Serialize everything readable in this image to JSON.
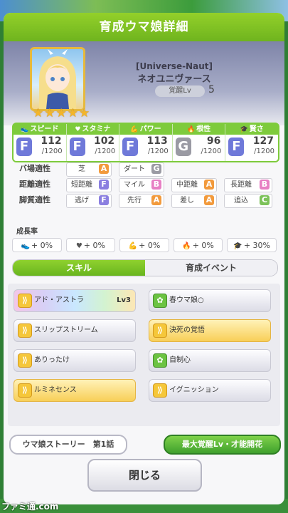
{
  "dialog": {
    "title": "育成ウマ娘詳細",
    "close_label": "閉じる"
  },
  "character": {
    "epithet": "[Universe-Naut]",
    "name": "ネオユニヴァース",
    "awakening_label": "覚醒Lv",
    "awakening_level": "5",
    "stars": [
      "★",
      "★",
      "★",
      "★",
      "★"
    ]
  },
  "stats": [
    {
      "label": "スピード",
      "icon": "shoe-icon",
      "grade": "F",
      "value": "112",
      "max": "/1200",
      "grade_color": "#6f79d9"
    },
    {
      "label": "スタミナ",
      "icon": "heart-icon",
      "grade": "F",
      "value": "102",
      "max": "/1200",
      "grade_color": "#6f79d9"
    },
    {
      "label": "パワー",
      "icon": "muscle-icon",
      "grade": "F",
      "value": "113",
      "max": "/1200",
      "grade_color": "#6f79d9"
    },
    {
      "label": "根性",
      "icon": "flame-icon",
      "grade": "G",
      "value": "96",
      "max": "/1200",
      "grade_color": "#9a9aa3"
    },
    {
      "label": "賢さ",
      "icon": "graduation-cap-icon",
      "grade": "F",
      "value": "127",
      "max": "/1200",
      "grade_color": "#6f79d9"
    }
  ],
  "aptitudes": {
    "track": {
      "label": "バ場適性",
      "items": [
        {
          "name": "芝",
          "grade": "A",
          "color": "#f29a3c"
        },
        {
          "name": "ダート",
          "grade": "G",
          "color": "#9a9aa3"
        }
      ]
    },
    "distance": {
      "label": "距離適性",
      "items": [
        {
          "name": "短距離",
          "grade": "F",
          "color": "#8b7fe0"
        },
        {
          "name": "マイル",
          "grade": "B",
          "color": "#e77fc4"
        },
        {
          "name": "中距離",
          "grade": "A",
          "color": "#f29a3c"
        },
        {
          "name": "長距離",
          "grade": "B",
          "color": "#e77fc4"
        }
      ]
    },
    "style": {
      "label": "脚質適性",
      "items": [
        {
          "name": "逃げ",
          "grade": "F",
          "color": "#8b7fe0"
        },
        {
          "name": "先行",
          "grade": "A",
          "color": "#f29a3c"
        },
        {
          "name": "差し",
          "grade": "A",
          "color": "#f29a3c"
        },
        {
          "name": "追込",
          "grade": "C",
          "color": "#7cc25a"
        }
      ]
    }
  },
  "growth": {
    "title": "成長率",
    "items": [
      {
        "icon": "shoe-icon",
        "glyph": "👟",
        "value": "+ 0%"
      },
      {
        "icon": "heart-icon",
        "glyph": "♥",
        "value": "+ 0%"
      },
      {
        "icon": "muscle-icon",
        "glyph": "💪",
        "value": "+ 0%"
      },
      {
        "icon": "flame-icon",
        "glyph": "🔥",
        "value": "+ 0%"
      },
      {
        "icon": "graduation-cap-icon",
        "glyph": "🎓",
        "value": "+ 30%"
      }
    ]
  },
  "tabs": [
    {
      "label": "スキル",
      "active": true
    },
    {
      "label": "育成イベント",
      "active": false
    }
  ],
  "skills": [
    {
      "name": "アド・アストラ",
      "level": "Lv3",
      "style": "rainbow",
      "icon": "green-speed-icon"
    },
    {
      "name": "春ウマ娘○",
      "level": "",
      "style": "normal",
      "icon": "green-skill-icon"
    },
    {
      "name": "スリップストリーム",
      "level": "",
      "style": "normal",
      "icon": "yellow-speed-icon"
    },
    {
      "name": "決死の覚悟",
      "level": "",
      "style": "gold",
      "icon": "yellow-speed-icon"
    },
    {
      "name": "ありったけ",
      "level": "",
      "style": "normal",
      "icon": "yellow-speed-icon"
    },
    {
      "name": "自制心",
      "level": "",
      "style": "normal",
      "icon": "green-skill-icon"
    },
    {
      "name": "ルミネセンス",
      "level": "",
      "style": "gold",
      "icon": "yellow-speed-icon"
    },
    {
      "name": "イグニッション",
      "level": "",
      "style": "normal",
      "icon": "yellow-speed-icon"
    }
  ],
  "buttons": {
    "story": "ウマ娘ストーリー　第1話",
    "awaken": "最大覚醒Lv・才能開花"
  },
  "watermark": "ファミ通.com"
}
